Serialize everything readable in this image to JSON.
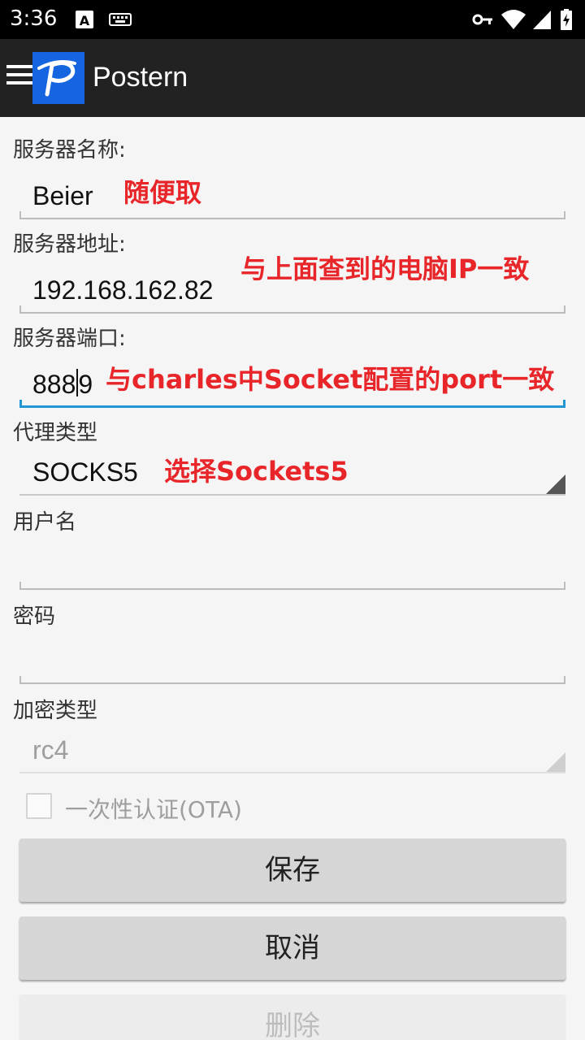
{
  "status_bar": {
    "time": "3:36",
    "icons": [
      "text-a-icon",
      "keyboard-icon",
      "vpn-key-icon",
      "wifi-icon",
      "signal-icon",
      "battery-charging-icon"
    ]
  },
  "app_bar": {
    "title": "Postern",
    "logo_icon": "postern-p-logo",
    "menu_icon": "hamburger-menu-icon"
  },
  "form": {
    "server_name": {
      "label": "服务器名称:",
      "value": "Beier",
      "annotation": "随便取"
    },
    "server_address": {
      "label": "服务器地址:",
      "value": "192.168.162.82",
      "annotation": "与上面查到的电脑IP一致"
    },
    "server_port": {
      "label": "服务器端口:",
      "value_before_cursor": "888",
      "value_after_cursor": "9",
      "annotation": "与charles中Socket配置的port一致"
    },
    "proxy_type": {
      "label": "代理类型",
      "value": "SOCKS5",
      "annotation": "选择Sockets5"
    },
    "username": {
      "label": "用户名",
      "value": ""
    },
    "password": {
      "label": "密码",
      "value": ""
    },
    "encryption": {
      "label": "加密类型",
      "value": "rc4"
    },
    "ota": {
      "label": "一次性认证(OTA)",
      "checked": false
    }
  },
  "buttons": {
    "save": "保存",
    "cancel": "取消",
    "delete": "删除"
  },
  "colors": {
    "app_bar": "#222222",
    "logo": "#1565e0",
    "focus_accent": "#2196d3",
    "annotation": "#e8262a"
  }
}
